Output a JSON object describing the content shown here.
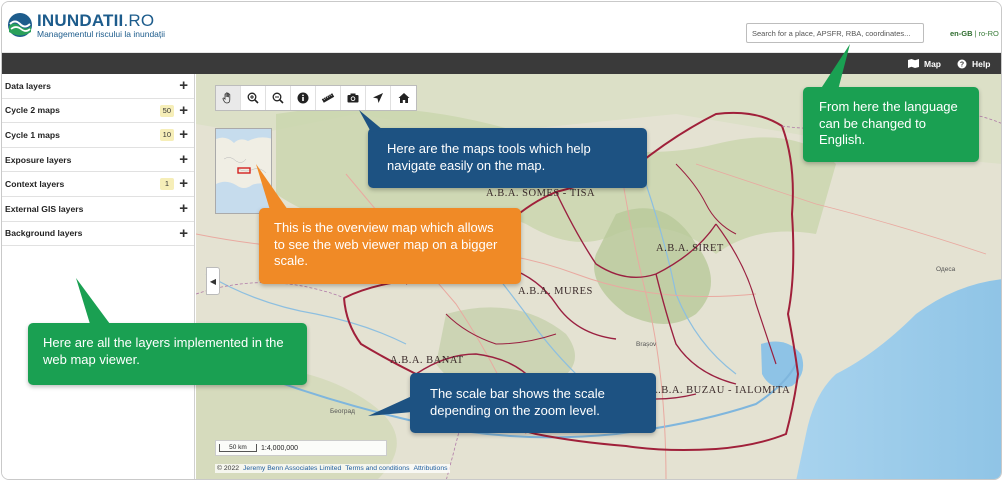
{
  "header": {
    "logo_title": "INUNDATII",
    "logo_title_suffix": ".RO",
    "logo_subtitle": "Managementul riscului la inundații",
    "search_placeholder": "Search for a place, APSFR, RBA, coordinates...",
    "lang_en": "en-GB",
    "lang_sep": "|",
    "lang_ro": "ro-RO"
  },
  "nav": {
    "map_label": "Map",
    "help_label": "Help"
  },
  "sidebar": {
    "items": [
      {
        "label": "Data layers",
        "count": ""
      },
      {
        "label": "Cycle 2 maps",
        "count": "50"
      },
      {
        "label": "Cycle 1 maps",
        "count": "10"
      },
      {
        "label": "Exposure layers",
        "count": ""
      },
      {
        "label": "Context layers",
        "count": "1"
      },
      {
        "label": "External GIS layers",
        "count": ""
      },
      {
        "label": "Background layers",
        "count": ""
      }
    ],
    "plus": "+",
    "collapse_arrow": "◀"
  },
  "map": {
    "tools": [
      "hand-icon",
      "zoom-in-icon",
      "zoom-out-icon",
      "info-icon",
      "ruler-icon",
      "camera-icon",
      "locate-arrow-icon",
      "home-icon"
    ],
    "regions": {
      "somes": "A.B.A. SOMES - TISA",
      "siret": "A.B.A. SIRET",
      "mures": "A.B.A. MURES",
      "banat": "A.B.A. BANAT",
      "buzau": "A.B.A. BUZAU - IALOMITA"
    },
    "cities": {
      "odesa": "Одеса",
      "beograd": "Београд",
      "brasov": "Brașov"
    },
    "scale_label": "50 km",
    "scale_ratio": "1:4,000,000",
    "attribution_prefix": "© 2022",
    "attribution_owner": "Jeremy Benn Associates Limited",
    "attribution_terms": "Terms and conditions",
    "attribution_link": "Attributions"
  },
  "callouts": {
    "tools": "Here are the maps tools which help navigate easily on the map.",
    "lang": "From here the language can be changed to English.",
    "overview": "This is the overview map which allows to see the web viewer map on a bigger scale.",
    "layers": "Here are all the layers implemented in the web map viewer.",
    "scale": "The scale bar shows the scale depending on the zoom level."
  },
  "colors": {
    "brand": "#1d5c8c",
    "navbar": "#3a3a3a",
    "callout_blue": "#1d5282",
    "callout_green": "#1aa052",
    "callout_orange": "#f08a26",
    "badge": "#f6eeb8",
    "border_red": "#a0203a",
    "water": "#9ccbea"
  }
}
